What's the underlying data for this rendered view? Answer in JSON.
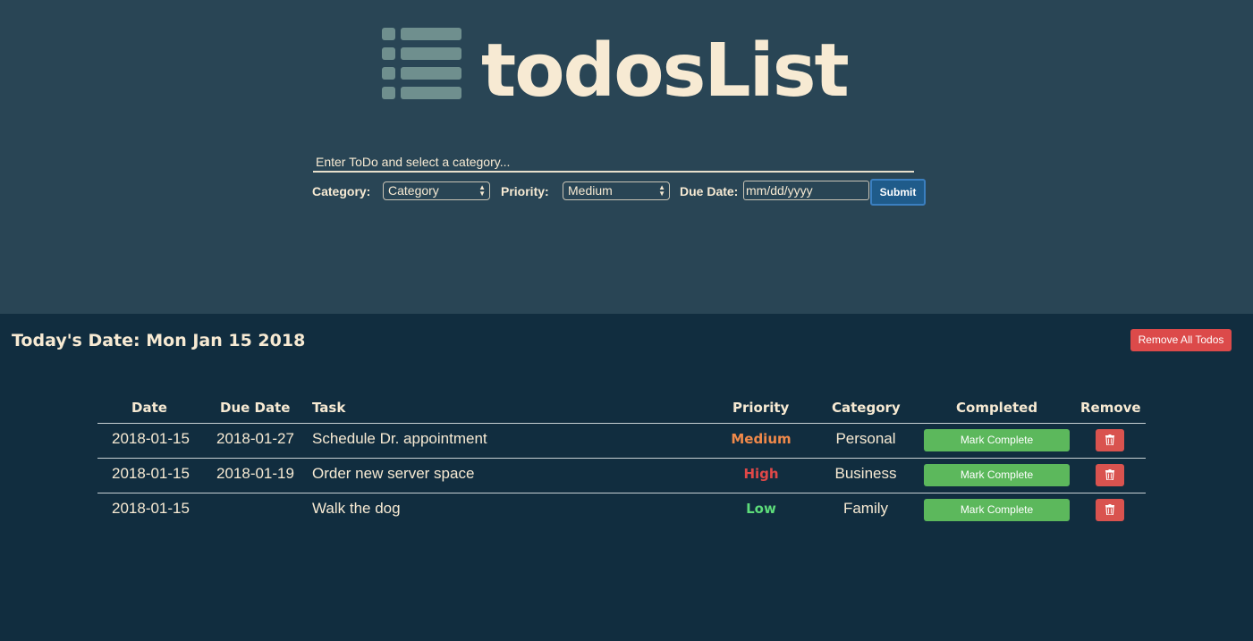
{
  "app": {
    "title": "todosList",
    "logo_icon": "list-icon"
  },
  "form": {
    "todo_placeholder": "Enter ToDo and select a category...",
    "category_label": "Category:",
    "category_value": "Category",
    "priority_label": "Priority:",
    "priority_value": "Medium",
    "due_date_label": "Due Date:",
    "due_date_placeholder": "mm/dd/yyyy",
    "submit_label": "Submit"
  },
  "today": {
    "label": "Today's Date: Mon Jan 15 2018"
  },
  "remove_all_label": "Remove All Todos",
  "table": {
    "headers": {
      "date": "Date",
      "due_date": "Due Date",
      "task": "Task",
      "priority": "Priority",
      "category": "Category",
      "completed": "Completed",
      "remove": "Remove"
    },
    "rows": [
      {
        "date": "2018-01-15",
        "due_date": "2018-01-27",
        "task": "Schedule Dr. appointment",
        "priority": "Medium",
        "priority_color": "#f0894a",
        "category": "Personal",
        "action": "Mark Complete",
        "remove_icon": "trash-icon"
      },
      {
        "date": "2018-01-15",
        "due_date": "2018-01-19",
        "task": "Order new server space",
        "priority": "High",
        "priority_color": "#e04848",
        "category": "Business",
        "action": "Mark Complete",
        "remove_icon": "trash-icon"
      },
      {
        "date": "2018-01-15",
        "due_date": "",
        "task": "Walk the dog",
        "priority": "Low",
        "priority_color": "#5ddc7a",
        "category": "Family",
        "action": "Mark Complete",
        "remove_icon": "trash-icon"
      }
    ]
  },
  "colors": {
    "header_bg": "#294555",
    "main_bg": "#112d3f",
    "text_cream": "#f7ead3",
    "submit_blue": "#1f5b8a",
    "danger_red": "#dc4a4a",
    "success_green": "#5cb85c"
  }
}
